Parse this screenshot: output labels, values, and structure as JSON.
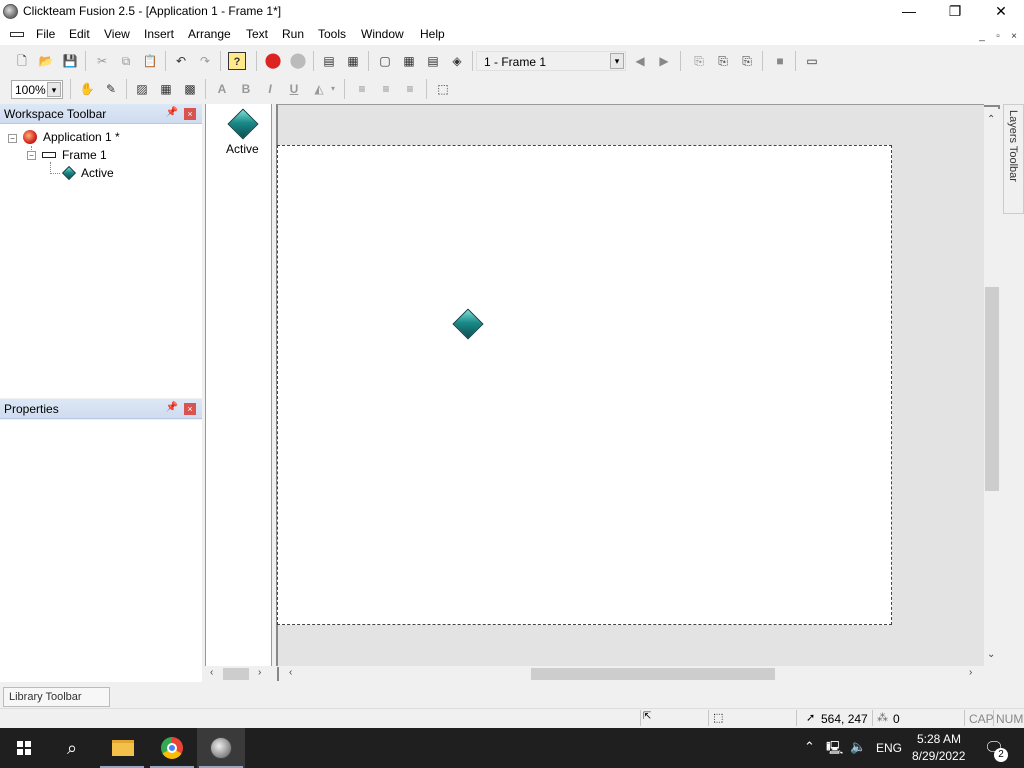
{
  "window": {
    "title": "Clickteam Fusion 2.5 - [Application 1 - Frame 1*]",
    "controls": [
      "—",
      "❐",
      "✕"
    ]
  },
  "menubar": {
    "items": [
      "File",
      "Edit",
      "View",
      "Insert",
      "Arrange",
      "Text",
      "Run",
      "Tools",
      "Window",
      "Help"
    ],
    "mdi_controls": [
      "_",
      "▫",
      "×"
    ]
  },
  "toolbar": {
    "frame_selector": "1 - Frame 1",
    "zoom": "100%",
    "icons": [
      "new-icon",
      "open-icon",
      "save-icon",
      "cut-icon",
      "copy-icon",
      "paste-icon",
      "undo-icon",
      "redo-icon",
      "help-icon",
      "stop-icon",
      "forward-icon",
      "list-icon",
      "grid-icon",
      "window-icon",
      "table-icon",
      "rows-icon",
      "object-icon",
      "prev-frame-icon",
      "next-frame-icon",
      "run-frame-icon",
      "run-app-icon",
      "run-other-icon",
      "stop-run-icon",
      "build-icon"
    ]
  },
  "workspace": {
    "title": "Workspace Toolbar",
    "tree": {
      "application": "Application 1 *",
      "frame": "Frame 1",
      "object": "Active"
    }
  },
  "properties": {
    "title": "Properties"
  },
  "object_shelf": {
    "items": [
      {
        "label": "Active",
        "icon": "active-object-icon"
      }
    ]
  },
  "layers_toolbar": {
    "label": "Layers Toolbar"
  },
  "library_toolbar": {
    "label": "Library Toolbar"
  },
  "statusbar": {
    "coords": "564, 247",
    "count": "0",
    "cap": "CAP",
    "num": "NUM"
  },
  "taskbar": {
    "language": "ENG",
    "time": "5:28 AM",
    "date": "8/29/2022",
    "notifications": "2"
  },
  "colors": {
    "panel_header": "#cfdcef",
    "active_object": "#1a8a88",
    "taskbar": "#1f1f1f"
  }
}
